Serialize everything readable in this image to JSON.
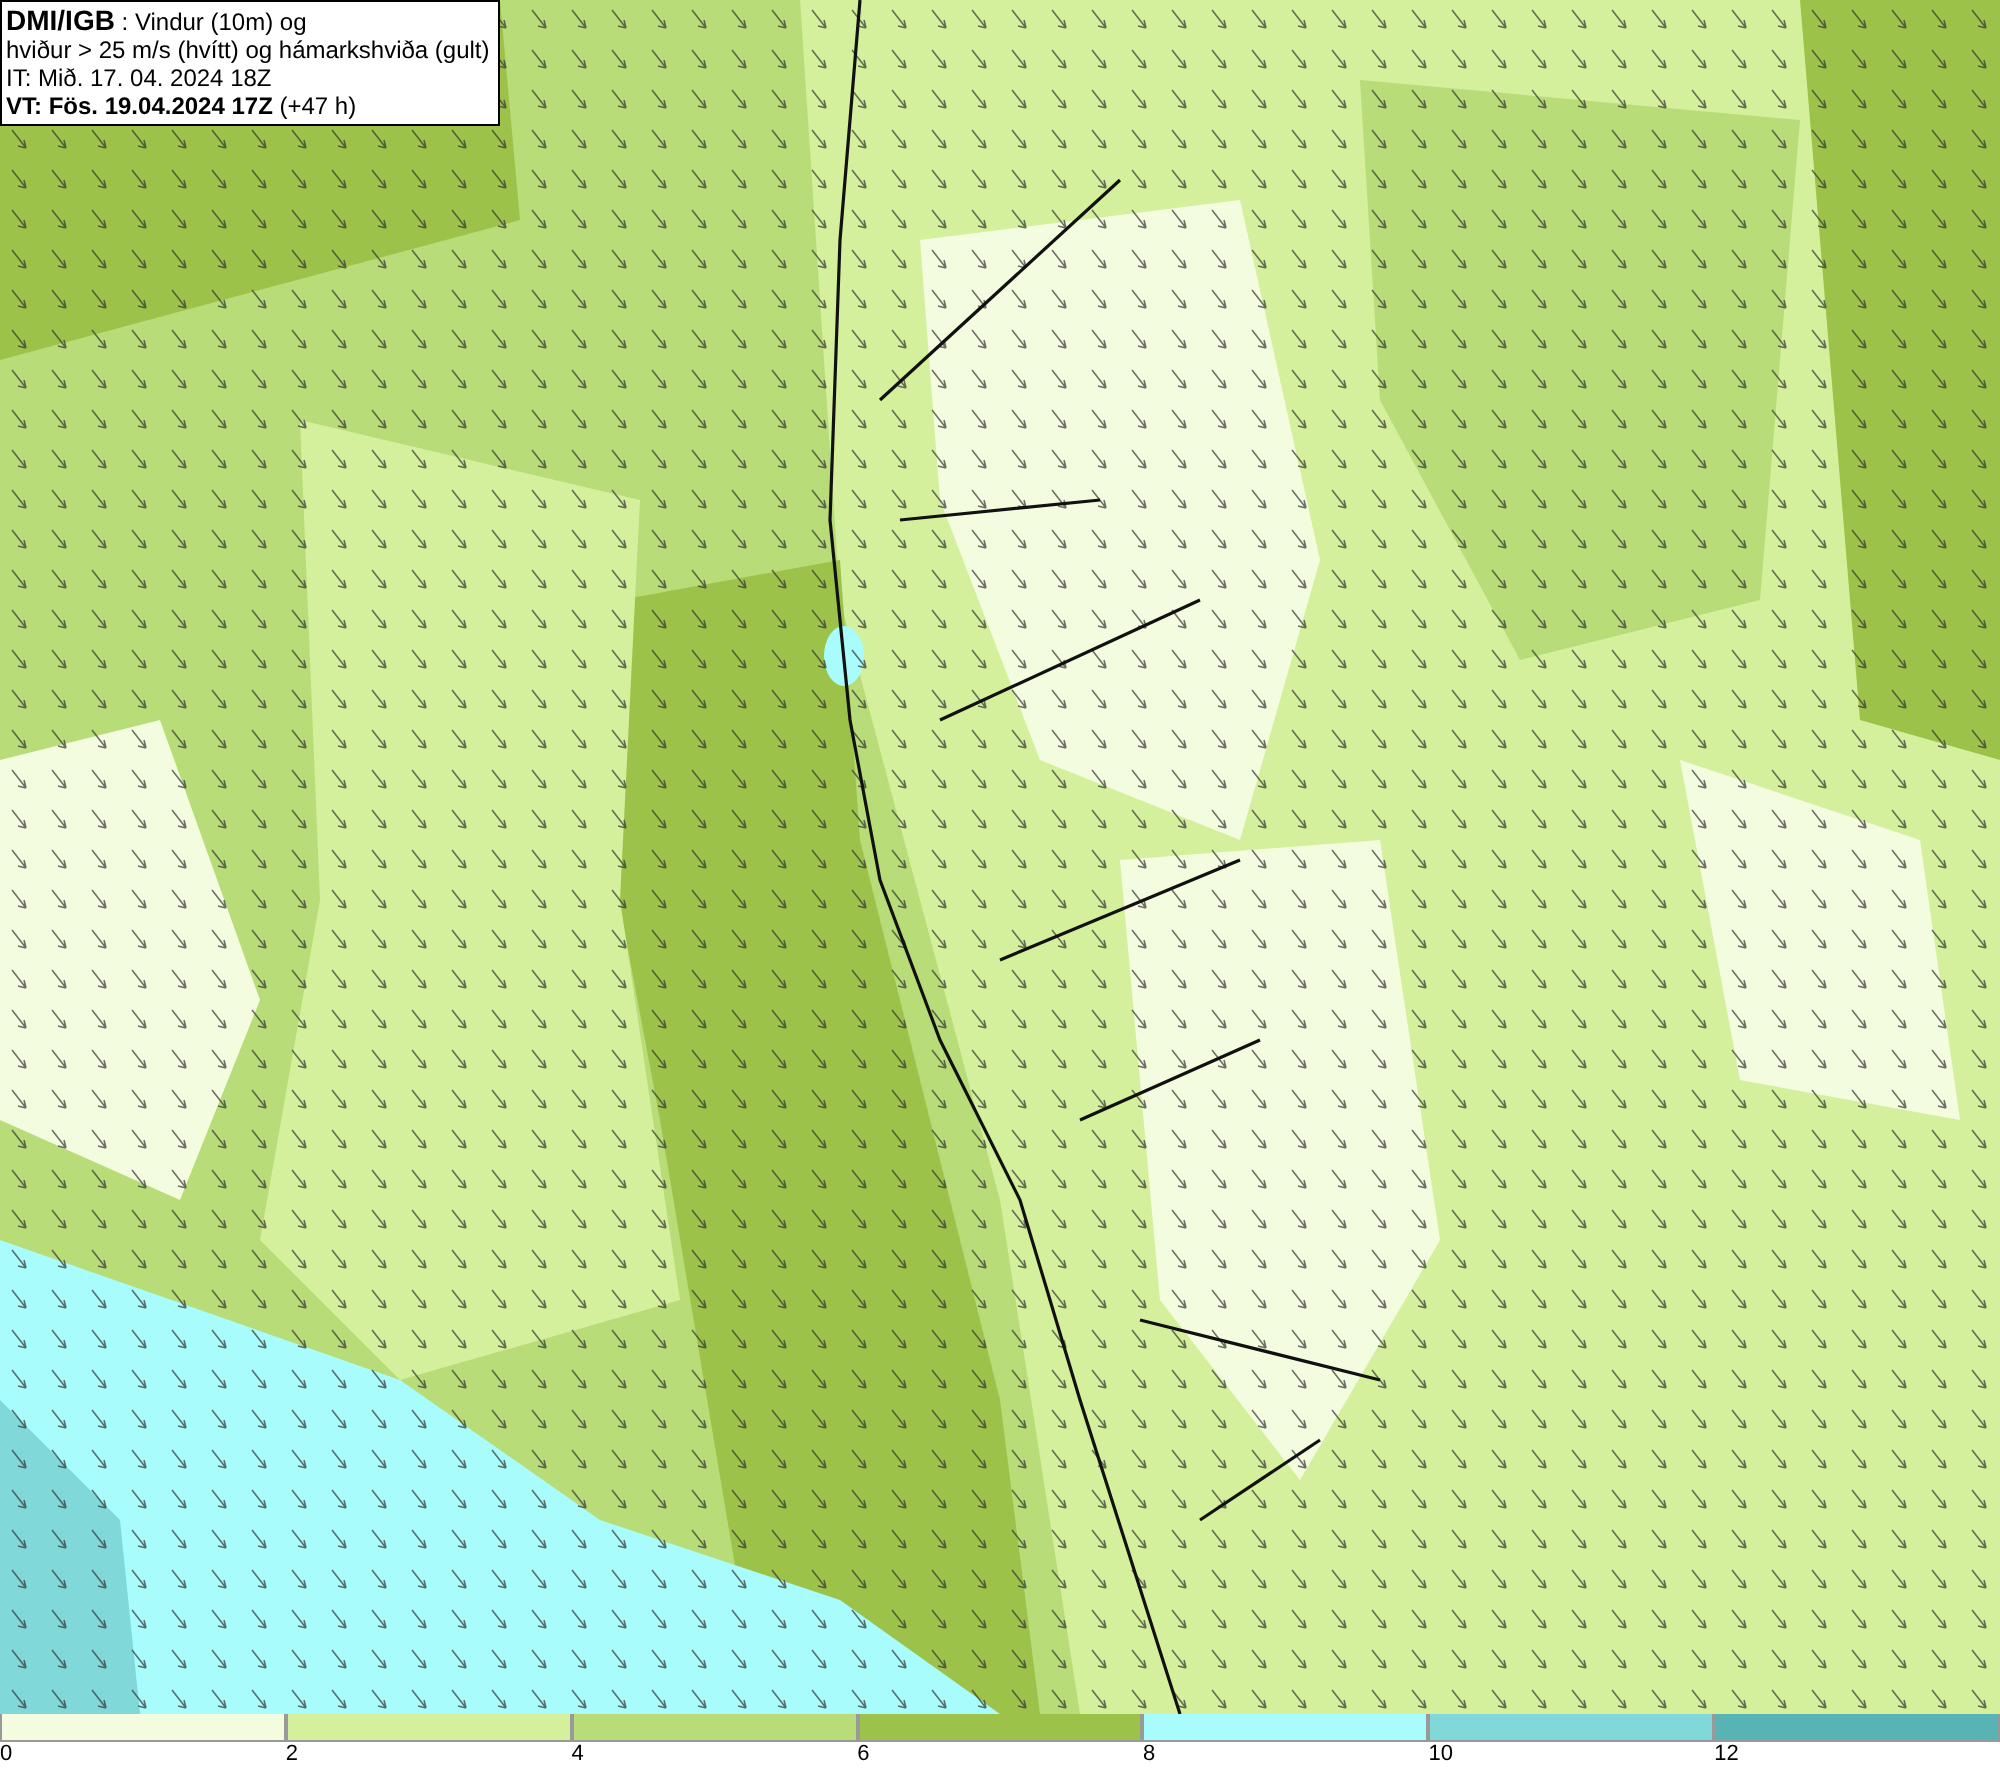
{
  "header": {
    "lines": [
      "**DMI/IGB** : Vindur (10m) og",
      "hviður > 25 m/s (hvítt) og hámarkshviða (gult)",
      "IT: Mið. 17. 04. 2024 18Z",
      "**VT: Fös. 19.04.2024 17Z** (+47 h)"
    ]
  },
  "legend": [
    {
      "label": "0",
      "color": "#f4fce0"
    },
    {
      "label": "2",
      "color": "#d5f09c"
    },
    {
      "label": "4",
      "color": "#b8dc78"
    },
    {
      "label": "6",
      "color": "#9cc24a"
    },
    {
      "label": "8",
      "color": "#a8fcfc"
    },
    {
      "label": "10",
      "color": "#80d8d8"
    },
    {
      "label": "12",
      "color": "#58b4b4"
    }
  ]
}
